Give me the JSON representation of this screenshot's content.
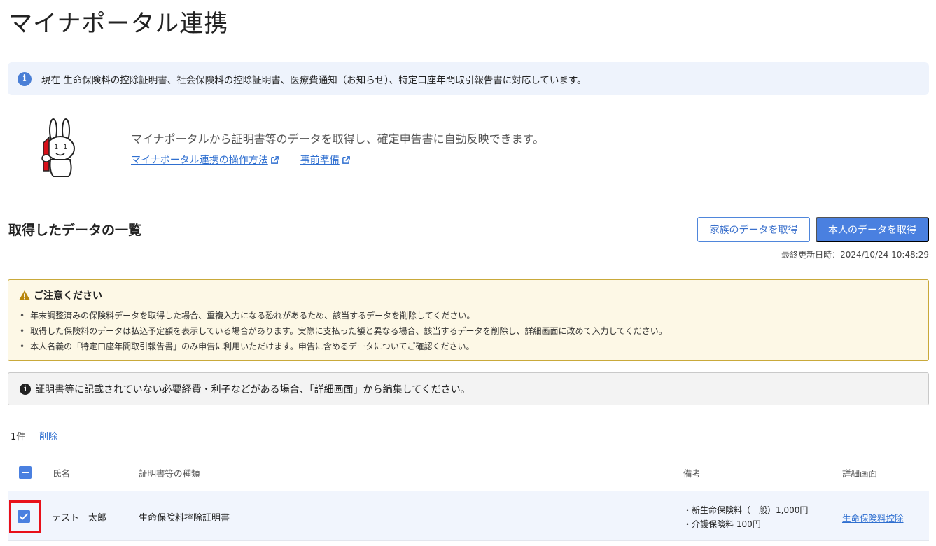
{
  "page": {
    "title": "マイナポータル連携"
  },
  "info_banner": {
    "text": "現在 生命保険料の控除証明書、社会保険料の控除証明書、医療費通知（お知らせ）、特定口座年間取引報告書に対応しています。"
  },
  "intro": {
    "description": "マイナポータルから証明書等のデータを取得し、確定申告書に自動反映できます。",
    "link_howto": "マイナポータル連携の操作方法",
    "link_prep": "事前準備"
  },
  "list": {
    "title": "取得したデータの一覧",
    "btn_family": "家族のデータを取得",
    "btn_self": "本人のデータを取得",
    "last_updated": "最終更新日時：2024/10/24 10:48:29"
  },
  "caution": {
    "title": "ご注意ください",
    "items": [
      "年末調整済みの保険料データを取得した場合、重複入力になる恐れがあるため、該当するデータを削除してください。",
      "取得した保険料のデータは払込予定額を表示している場合があります。実際に支払った額と異なる場合、該当するデータを削除し、詳細画面に改めて入力してください。",
      "本人名義の「特定口座年間取引報告書」のみ申告に利用いただけます。申告に含めるデータについてご確認ください。"
    ]
  },
  "notice": {
    "text": "証明書等に記載されていない必要経費・利子などがある場合、「詳細画面」から編集してください。"
  },
  "table": {
    "count": "1件",
    "delete_label": "削除",
    "headers": {
      "name": "氏名",
      "type": "証明書等の種類",
      "note": "備考",
      "detail": "詳細画面"
    },
    "rows": [
      {
        "name": "テスト　太郎",
        "type": "生命保険料控除証明書",
        "note_lines": [
          "・新生命保険料（一般）1,000円",
          "・介護保険料 100円"
        ],
        "detail_link": "生命保険料控除"
      }
    ]
  },
  "colors": {
    "accent": "#4a80e0",
    "link": "#2f6fd0",
    "highlight": "#e8101a"
  }
}
